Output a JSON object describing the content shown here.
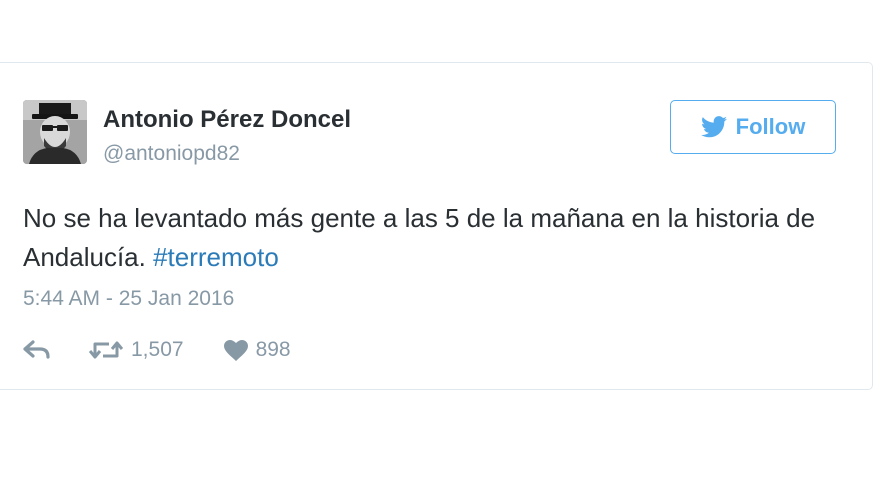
{
  "tweet": {
    "author": {
      "name": "Antonio Pérez Doncel",
      "handle": "@antoniopd82"
    },
    "follow_button": {
      "label": "Follow"
    },
    "text": {
      "body": "No se ha levantado más gente a las 5 de la mañana en la historia de Andalucía. ",
      "hashtag": "#terremoto"
    },
    "timestamp": "5:44 AM - 25 Jan 2016",
    "actions": {
      "retweet_count": "1,507",
      "like_count": "898"
    }
  },
  "colors": {
    "brand": "#55acee",
    "link": "#2b7bb9",
    "muted": "#8899a6",
    "text": "#292f33"
  },
  "icons": [
    "bird-icon",
    "reply-icon",
    "retweet-icon",
    "heart-icon"
  ]
}
